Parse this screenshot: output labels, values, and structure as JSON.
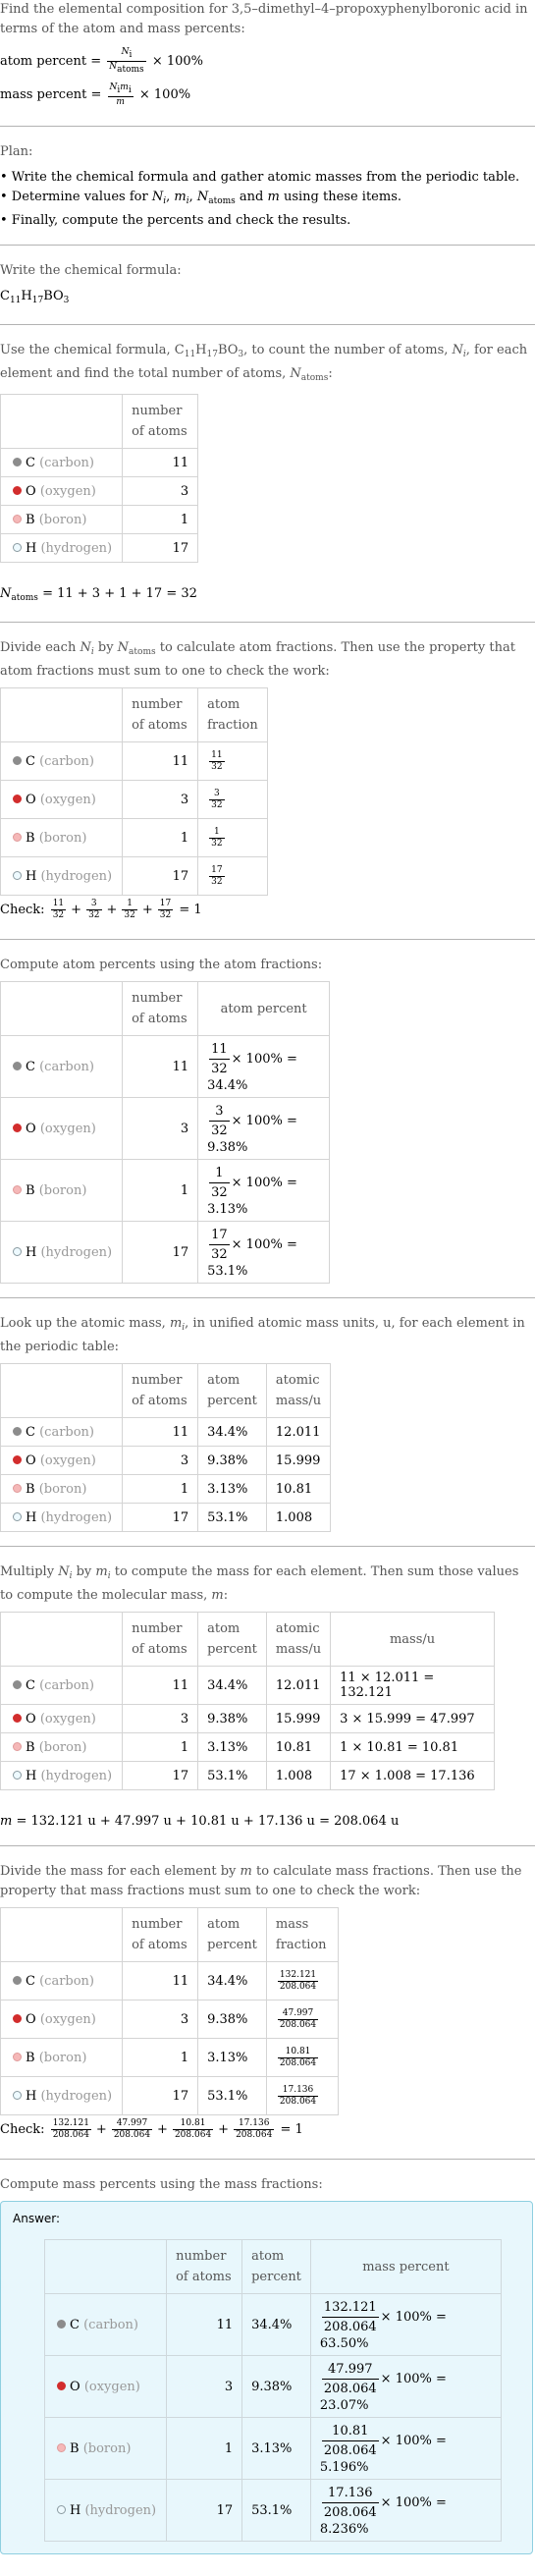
{
  "header": {
    "question": "Find the elemental composition for 3,5–dimethyl–4–propoxyphenylboronic acid in terms of the atom and mass percents:",
    "atom_percent_label": "atom percent =",
    "mass_percent_label": "mass percent =",
    "atom_formula": {
      "num": "N",
      "num_sub": "i",
      "den": "N",
      "den_sub": "atoms",
      "times": "× 100%"
    },
    "mass_formula": {
      "num": "N",
      "num_sub": "i",
      "num2": "m",
      "num2_sub": "i",
      "den": "m",
      "times": "× 100%"
    }
  },
  "plan": {
    "title": "Plan:",
    "items": [
      "• Write the chemical formula and gather atomic masses from the periodic table.",
      "• Determine values for Nᵢ, mᵢ, N_atoms and m using these items.",
      "• Finally, compute the percents and check the results."
    ],
    "item2_parts": {
      "pre": "• Determine values for ",
      "n": "N",
      "i": "i",
      "m": "m",
      "natoms": "N",
      "atoms": "atoms",
      "and": " and ",
      "post": " using these items."
    }
  },
  "formula_section": {
    "intro": "Write the chemical formula:",
    "formula_parts": [
      "C",
      "11",
      "H",
      "17",
      "BO",
      "3"
    ]
  },
  "elements": [
    {
      "symbol": "C",
      "name": "(carbon)",
      "color": "#8c8c8c",
      "border": "#8c8c8c",
      "count": "11",
      "frac_num": "11",
      "frac_den": "32",
      "atom_percent": "34.4%",
      "atomic_mass": "12.011",
      "mass_expr": "11 × 12.011 = 132.121",
      "mass": "132.121",
      "mass_percent": "63.50%"
    },
    {
      "symbol": "O",
      "name": "(oxygen)",
      "color": "#d22d2d",
      "border": "#d22d2d",
      "count": "3",
      "frac_num": "3",
      "frac_den": "32",
      "atom_percent": "9.38%",
      "atomic_mass": "15.999",
      "mass_expr": "3 × 15.999 = 47.997",
      "mass": "47.997",
      "mass_percent": "23.07%"
    },
    {
      "symbol": "B",
      "name": "(boron)",
      "color": "#f5b8b8",
      "border": "#e09a9a",
      "count": "1",
      "frac_num": "1",
      "frac_den": "32",
      "atom_percent": "3.13%",
      "atomic_mass": "10.81",
      "mass_expr": "1 × 10.81 = 10.81",
      "mass": "10.81",
      "mass_percent": "5.196%"
    },
    {
      "symbol": "H",
      "name": "(hydrogen)",
      "color": "#eefaff",
      "border": "#8a9aa0",
      "count": "17",
      "frac_num": "17",
      "frac_den": "32",
      "atom_percent": "53.1%",
      "atomic_mass": "1.008",
      "mass_expr": "17 × 1.008 = 17.136",
      "mass": "17.136",
      "mass_percent": "8.236%"
    }
  ],
  "count_section": {
    "intro_a": "Use the chemical formula, ",
    "intro_b": ", to count the number of atoms, ",
    "intro_c": ", for each element and find the total number of atoms, ",
    "intro_d": ":",
    "col_count": "number of atoms",
    "total_expr": "= 11 + 3 + 1 + 17 = 32"
  },
  "fraction_section": {
    "intro_a": "Divide each ",
    "intro_b": " by ",
    "intro_c": " to calculate atom fractions. Then use the property that atom fractions must sum to one to check the work:",
    "col_count": "number of atoms",
    "col_fraction": "atom fraction",
    "check_label": "Check:",
    "check_result": "= 1",
    "plus": "+"
  },
  "atom_percent_section": {
    "intro": "Compute atom percents using the atom fractions:",
    "col_count": "number of atoms",
    "col_percent": "atom percent",
    "times": "× 100% ="
  },
  "mass_lookup_section": {
    "intro_a": "Look up the atomic mass, ",
    "intro_b": ", in unified atomic mass units, u, for each element in the periodic table:",
    "col_count": "number of atoms",
    "col_percent": "atom percent",
    "col_mass": "atomic mass/u"
  },
  "molecular_mass_section": {
    "intro_a": "Multiply ",
    "intro_b": " by ",
    "intro_c": " to compute the mass for each element. Then sum those values to compute the molecular mass, ",
    "intro_d": ":",
    "col_count": "number of atoms",
    "col_percent": "atom percent",
    "col_atomic": "atomic mass/u",
    "col_mass": "mass/u",
    "total_expr": "= 132.121 u + 47.997 u + 10.81 u + 17.136 u = 208.064 u",
    "total_mass": "208.064"
  },
  "mass_fraction_section": {
    "intro_a": "Divide the mass for each element by ",
    "intro_b": " to calculate mass fractions. Then use the property that mass fractions must sum to one to check the work:",
    "col_count": "number of atoms",
    "col_percent": "atom percent",
    "col_fraction": "mass fraction",
    "check_label": "Check:",
    "check_result": "= 1",
    "plus": "+"
  },
  "answer_section": {
    "intro": "Compute mass percents using the mass fractions:",
    "answer_label": "Answer:",
    "col_count": "number of atoms",
    "col_percent": "atom percent",
    "col_mass_percent": "mass percent",
    "times": "× 100% ="
  }
}
